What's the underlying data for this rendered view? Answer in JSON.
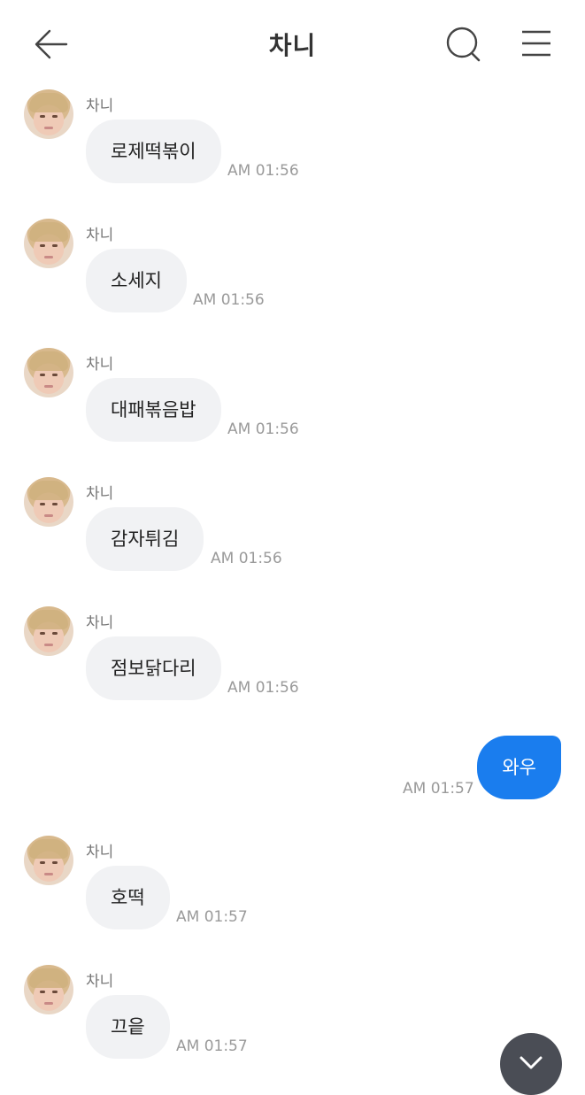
{
  "header": {
    "title": "차니",
    "back_icon": "back-arrow-icon",
    "search_icon": "search-icon",
    "menu_icon": "hamburger-menu-icon"
  },
  "messages": [
    {
      "sender": "차니",
      "text": "로제떡볶이",
      "time": "AM 01:56",
      "mine": false
    },
    {
      "sender": "차니",
      "text": "소세지",
      "time": "AM 01:56",
      "mine": false
    },
    {
      "sender": "차니",
      "text": "대패볶음밥",
      "time": "AM 01:56",
      "mine": false
    },
    {
      "sender": "차니",
      "text": "감자튀김",
      "time": "AM 01:56",
      "mine": false
    },
    {
      "sender": "차니",
      "text": "점보닭다리",
      "time": "AM 01:56",
      "mine": false
    },
    {
      "text": "와우",
      "time": "AM 01:57",
      "mine": true
    },
    {
      "sender": "차니",
      "text": "호떡",
      "time": "AM 01:57",
      "mine": false
    },
    {
      "sender": "차니",
      "text": "끄읕",
      "time": "AM 01:57",
      "mine": false
    }
  ],
  "colors": {
    "my_bubble": "#1a7dee",
    "their_bubble": "#f1f2f4",
    "scroll_button": "#4a4d55"
  },
  "scroll_button_icon": "chevron-down-icon"
}
